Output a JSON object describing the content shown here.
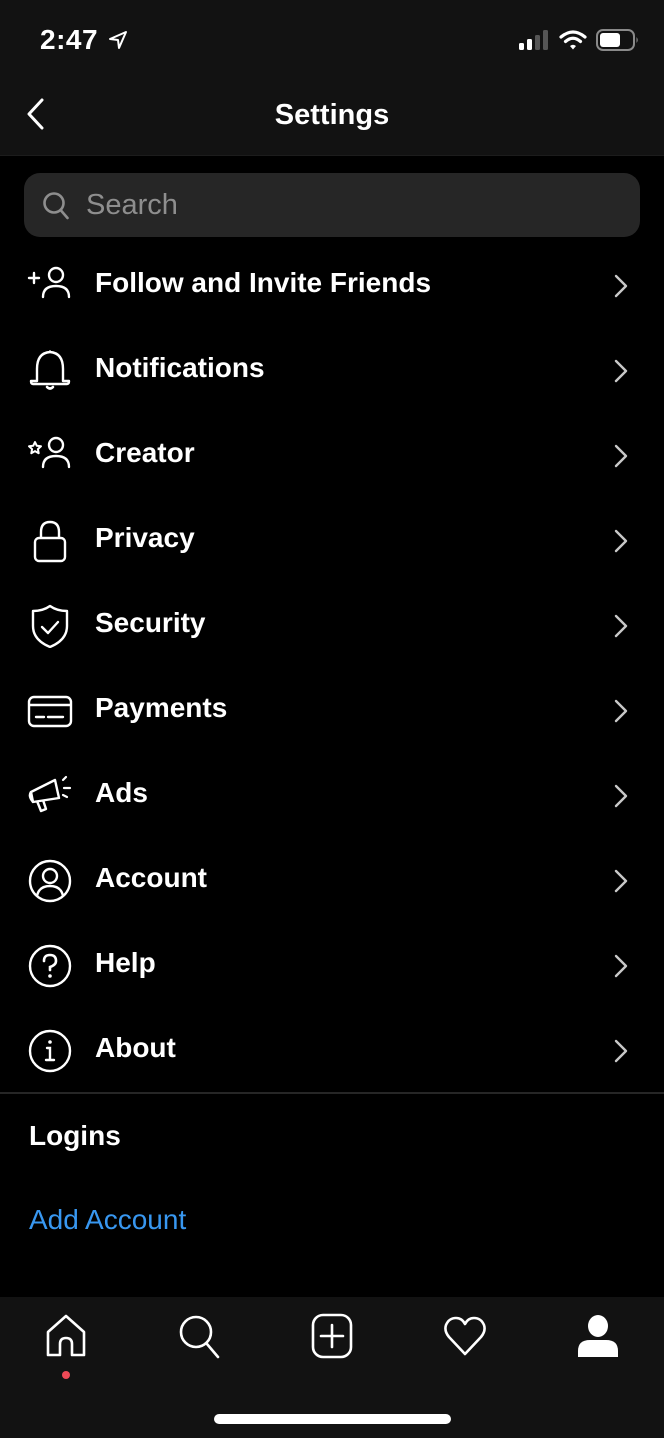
{
  "status_bar": {
    "time": "2:47",
    "location_icon": "location-arrow-icon",
    "signal_bars_active": 2,
    "signal_bars_total": 4,
    "battery_level_percent": 60
  },
  "header": {
    "title": "Settings",
    "back_icon": "chevron-left-icon"
  },
  "search": {
    "placeholder": "Search",
    "value": "",
    "icon": "search-icon"
  },
  "menu": {
    "items": [
      {
        "label": "Follow and Invite Friends",
        "icon": "add-person-icon"
      },
      {
        "label": "Notifications",
        "icon": "bell-icon"
      },
      {
        "label": "Creator",
        "icon": "star-person-icon"
      },
      {
        "label": "Privacy",
        "icon": "lock-icon"
      },
      {
        "label": "Security",
        "icon": "shield-check-icon"
      },
      {
        "label": "Payments",
        "icon": "credit-card-icon"
      },
      {
        "label": "Ads",
        "icon": "megaphone-icon"
      },
      {
        "label": "Account",
        "icon": "person-circle-icon"
      },
      {
        "label": "Help",
        "icon": "question-circle-icon"
      },
      {
        "label": "About",
        "icon": "info-circle-icon"
      }
    ]
  },
  "logins": {
    "section_title": "Logins",
    "add_account_label": "Add Account"
  },
  "tab_bar": {
    "tabs": [
      {
        "name": "home",
        "icon": "home-icon",
        "has_notification_dot": true
      },
      {
        "name": "search",
        "icon": "search-icon"
      },
      {
        "name": "new-post",
        "icon": "plus-square-icon"
      },
      {
        "name": "activity",
        "icon": "heart-icon"
      },
      {
        "name": "profile",
        "icon": "profile-icon",
        "active": true
      }
    ]
  },
  "colors": {
    "background": "#000000",
    "bar_background": "#121212",
    "search_background": "#262626",
    "link_blue": "#3897f0",
    "placeholder_gray": "#8e8e8e",
    "notification_red": "#ed4956"
  }
}
